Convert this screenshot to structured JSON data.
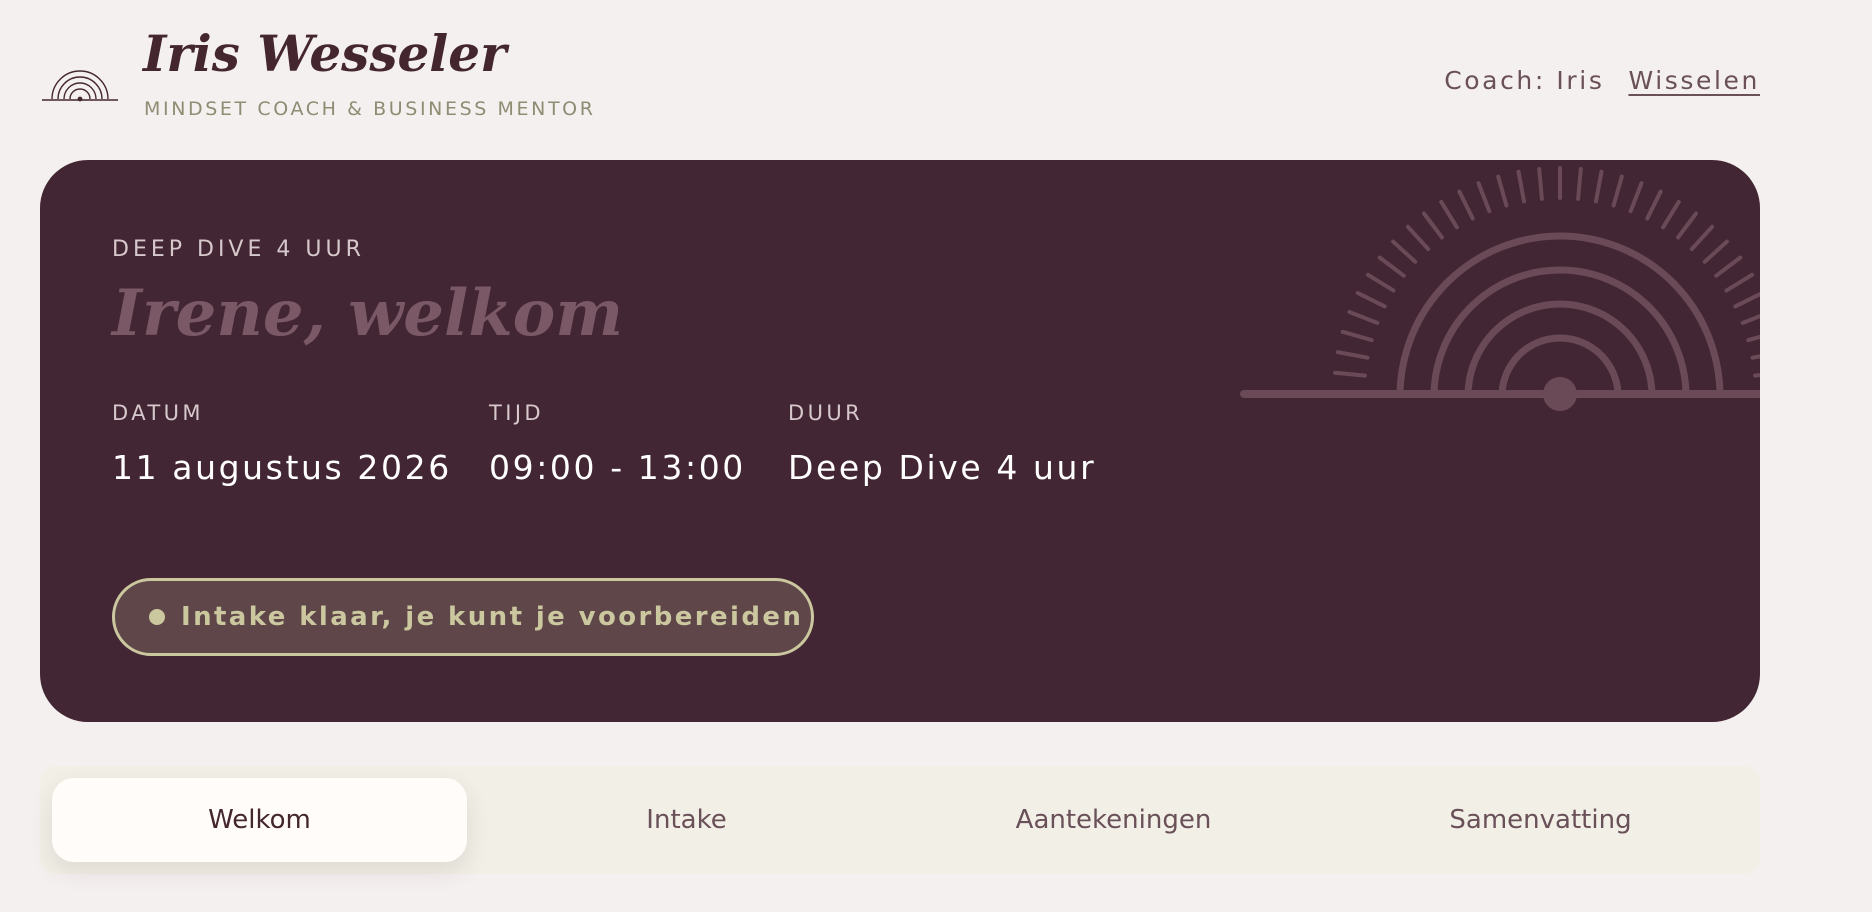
{
  "brand": {
    "name": "Iris Wesseler",
    "tagline": "MINDSET COACH & BUSINESS MENTOR",
    "logo_icon": "sunrise-icon"
  },
  "coach": {
    "label": "Coach: Iris",
    "switch_label": "Wisselen"
  },
  "session": {
    "eyebrow": "DEEP DIVE 4 UUR",
    "welcome": "Irene, welkom",
    "details": {
      "date_label": "DATUM",
      "date_value": "11 augustus 2026",
      "time_label": "TIJD",
      "time_value": "09:00 - 13:00",
      "duration_label": "DUUR",
      "duration_value": "Deep Dive 4 uur"
    },
    "status": "Intake klaar, je kunt je voorbereiden",
    "decoration_icon": "sunrise-icon"
  },
  "tabs": [
    {
      "label": "Welkom",
      "active": true
    },
    {
      "label": "Intake",
      "active": false
    },
    {
      "label": "Aantekeningen",
      "active": false
    },
    {
      "label": "Samenvatting",
      "active": false
    }
  ],
  "colors": {
    "plum": "#432633",
    "text_dark": "#44262f",
    "accent_sage": "#cbc79f",
    "background": "#f5f0f0"
  }
}
